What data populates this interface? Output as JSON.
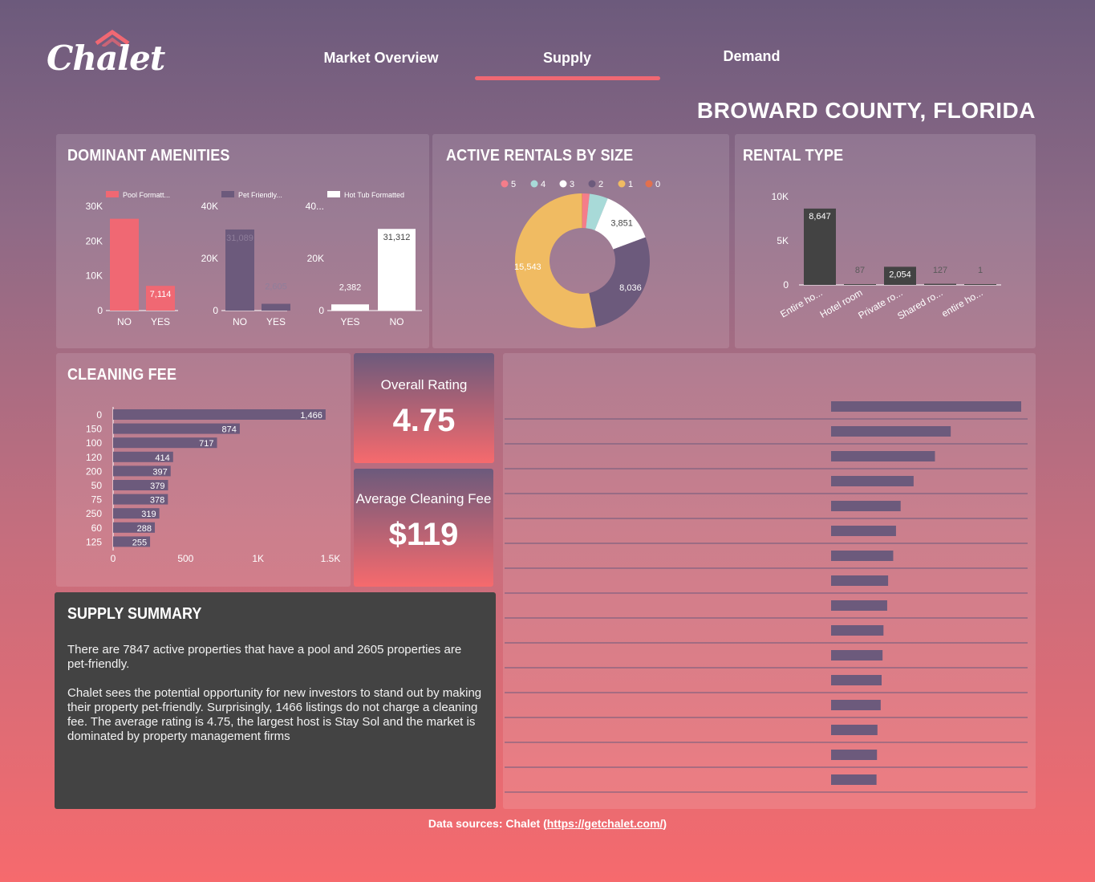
{
  "brand": {
    "name": "Chalet"
  },
  "nav": {
    "tabs": [
      {
        "label": "Market Overview"
      },
      {
        "label": "Supply"
      },
      {
        "label": "Demand"
      }
    ],
    "active_index": 1
  },
  "region_title": "BROWARD COUNTY, FLORIDA",
  "colors": {
    "accent": "#f06873",
    "purple": "#6c5a7c",
    "dark": "#434343",
    "yellow": "#f0bb62",
    "teal": "#a8dad8"
  },
  "amenities": {
    "title": "DOMINANT AMENITIES",
    "charts": [
      {
        "legend": "Pool Formatt...",
        "ticks": [
          "30K",
          "20K",
          "10K",
          "0"
        ],
        "categories": [
          "NO",
          "YES"
        ],
        "labels": [
          "",
          "7,114"
        ]
      },
      {
        "legend": "Pet Friendly...",
        "ticks": [
          "40K",
          "20K",
          "0"
        ],
        "categories": [
          "NO",
          "YES"
        ],
        "labels": [
          "31,089",
          "2,605"
        ]
      },
      {
        "legend": "Hot Tub Formatted",
        "ticks": [
          "40...",
          "20K",
          "0"
        ],
        "categories": [
          "YES",
          "NO"
        ],
        "labels": [
          "2,382",
          "31,312"
        ]
      }
    ]
  },
  "rentals_by_size": {
    "title": "ACTIVE RENTALS BY SIZE",
    "legend": [
      "5",
      "4",
      "3",
      "2",
      "1",
      "0"
    ],
    "labels": [
      "3,851",
      "8,036",
      "15,543"
    ]
  },
  "rental_type": {
    "title": "RENTAL TYPE",
    "ticks": [
      "10K",
      "5K",
      "0"
    ],
    "categories": [
      "Entire ho...",
      "Hotel room",
      "Private ro...",
      "Shared ro...",
      "entire ho..."
    ],
    "labels": [
      "8,647",
      "87",
      "2,054",
      "127",
      "1"
    ]
  },
  "cleaning_fee": {
    "title": "CLEANING FEE",
    "categories": [
      "0",
      "150",
      "100",
      "120",
      "200",
      "50",
      "75",
      "250",
      "60",
      "125"
    ],
    "labels": [
      "1,466",
      "874",
      "717",
      "414",
      "397",
      "379",
      "378",
      "319",
      "288",
      "255"
    ],
    "ticks": [
      "0",
      "500",
      "1K",
      "1.5K"
    ]
  },
  "kpis": {
    "rating_label": "Overall Rating",
    "rating_value": "4.75",
    "fee_label": "Average Cleaning Fee",
    "fee_value": "$119"
  },
  "summary": {
    "title": "SUPPLY SUMMARY",
    "p1": "There are 7847 active properties that have a pool and 2605 properties are pet-friendly.",
    "p2": "Chalet sees the potential opportunity for new investors to stand out by making their property pet-friendly. Surprisingly, 1466 listings do not charge a cleaning fee. The average rating is 4.75, the largest host is Stay Sol and the market is dominated by property management firms"
  },
  "footer": {
    "prefix": "Data sources: Chalet (",
    "link": "https://getchalet.com/",
    "suffix": ")"
  },
  "chart_data": [
    {
      "type": "bar",
      "title": "DOMINANT AMENITIES",
      "series": [
        {
          "name": "Pool Formatt...",
          "categories": [
            "NO",
            "YES"
          ],
          "values": [
            26400,
            7114
          ]
        },
        {
          "name": "Pet Friendly...",
          "categories": [
            "NO",
            "YES"
          ],
          "values": [
            31089,
            2605
          ]
        },
        {
          "name": "Hot Tub Formatted",
          "categories": [
            "YES",
            "NO"
          ],
          "values": [
            2382,
            31312
          ]
        }
      ]
    },
    {
      "type": "pie",
      "title": "ACTIVE RENTALS BY SIZE",
      "categories": [
        "5",
        "4",
        "3",
        "2",
        "1",
        "0"
      ],
      "values": [
        500,
        1300,
        3851,
        8036,
        15543,
        30
      ],
      "colors": [
        "#f47d8a",
        "#a8dad8",
        "#ffffff",
        "#6c5a7c",
        "#f0bb62",
        "#e2704e"
      ]
    },
    {
      "type": "bar",
      "title": "RENTAL TYPE",
      "categories": [
        "Entire ho...",
        "Hotel room",
        "Private ro...",
        "Shared ro...",
        "entire ho..."
      ],
      "values": [
        8647,
        87,
        2054,
        127,
        1
      ],
      "ylim": [
        0,
        10000
      ]
    },
    {
      "type": "bar",
      "title": "CLEANING FEE",
      "categories": [
        "0",
        "150",
        "100",
        "120",
        "200",
        "50",
        "75",
        "250",
        "60",
        "125"
      ],
      "values": [
        1466,
        874,
        717,
        414,
        397,
        379,
        378,
        319,
        288,
        255
      ],
      "xlim": [
        0,
        1500
      ]
    },
    {
      "type": "bar",
      "title": "",
      "values": [
        2050,
        1290,
        1120,
        890,
        750,
        700,
        670,
        615,
        605,
        565,
        555,
        545,
        535,
        500,
        495,
        490
      ]
    }
  ]
}
